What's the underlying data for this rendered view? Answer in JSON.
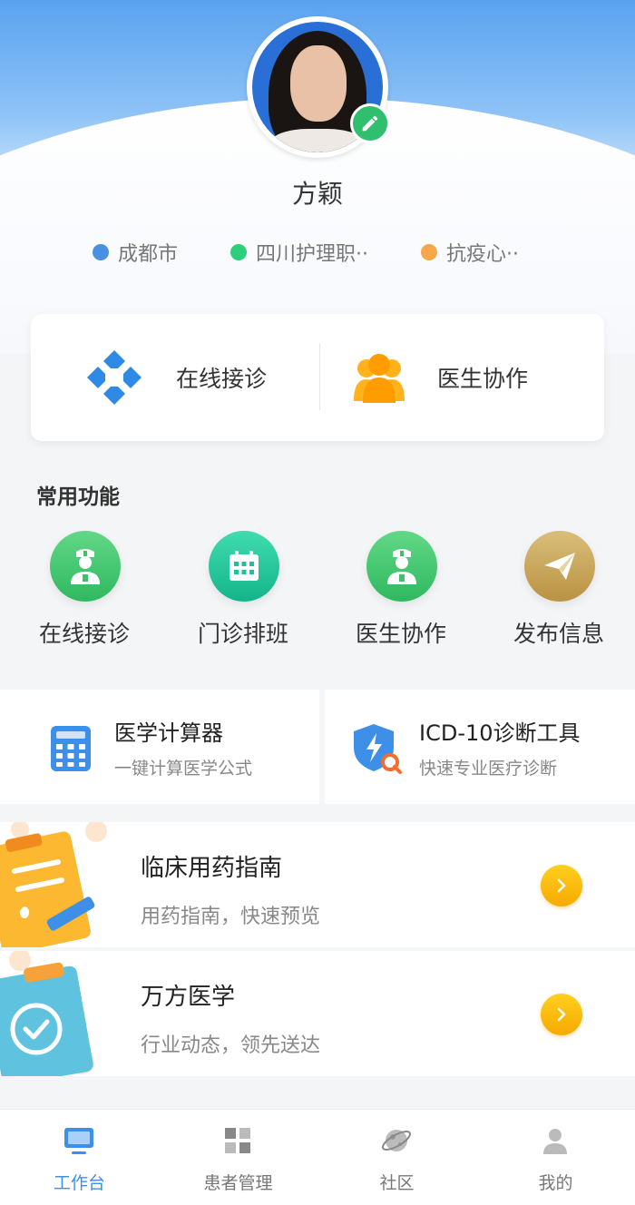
{
  "profile": {
    "name": "方颖",
    "tags": [
      {
        "label": "成都市",
        "color": "#4a90e2"
      },
      {
        "label": "四川护理职··",
        "color": "#2ecf7a"
      },
      {
        "label": "抗疫心··",
        "color": "#f7a64a"
      }
    ]
  },
  "main_actions": [
    {
      "label": "在线接诊",
      "icon": "medical-cross-icon"
    },
    {
      "label": "医生协作",
      "icon": "doctors-group-icon"
    }
  ],
  "common_functions": {
    "title": "常用功能",
    "items": [
      {
        "label": "在线接诊",
        "icon": "nurse-icon",
        "color": "#3cc26a"
      },
      {
        "label": "门诊排班",
        "icon": "calendar-icon",
        "color": "#20c09a"
      },
      {
        "label": "医生协作",
        "icon": "nurse-icon",
        "color": "#3cc26a"
      },
      {
        "label": "发布信息",
        "icon": "paper-plane-icon",
        "color": "#c9a85a"
      }
    ]
  },
  "tools": [
    {
      "title": "医学计算器",
      "subtitle": "一键计算医学公式",
      "icon": "calculator-icon"
    },
    {
      "title": "ICD-10诊断工具",
      "subtitle": "快速专业医疗诊断",
      "icon": "shield-search-icon"
    }
  ],
  "list_items": [
    {
      "title": "临床用药指南",
      "subtitle": "用药指南，快速预览",
      "icon": "clipboard-pen-icon"
    },
    {
      "title": "万方医学",
      "subtitle": "行业动态，领先送达",
      "icon": "clipboard-check-icon"
    }
  ],
  "bottom_nav": [
    {
      "label": "工作台",
      "icon": "monitor-icon",
      "active": true
    },
    {
      "label": "患者管理",
      "icon": "grid-icon",
      "active": false
    },
    {
      "label": "社区",
      "icon": "planet-icon",
      "active": false
    },
    {
      "label": "我的",
      "icon": "user-icon",
      "active": false
    }
  ],
  "colors": {
    "accent": "#3d8fe8",
    "header_blue": "#5aa2ef",
    "edit_green": "#2fbf6f",
    "arrow_yellow": "#f7b500"
  }
}
